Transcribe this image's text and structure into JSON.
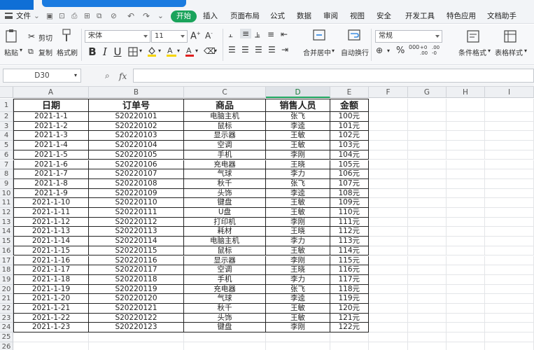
{
  "menu": {
    "file_label": "文件",
    "tabs": [
      "开始",
      "插入",
      "页面布局",
      "公式",
      "数据",
      "审阅",
      "视图",
      "安全",
      "开发工具",
      "特色应用",
      "文档助手"
    ],
    "active_tab": 0
  },
  "ribbon": {
    "paste": "粘贴",
    "cut": "剪切",
    "copy": "复制",
    "format_painter": "格式刷",
    "font_name": "宋体",
    "font_size": "11",
    "bold": "B",
    "italic": "I",
    "underline": "U",
    "merge_center": "合并居中",
    "wrap_text": "自动换行",
    "number_format": "常规",
    "percent": "%",
    "conditional_format": "条件格式",
    "table_style": "表格样式"
  },
  "formula_bar": {
    "name_box": "D30",
    "fx": "fx",
    "value": ""
  },
  "grid": {
    "columns": [
      "A",
      "B",
      "C",
      "D",
      "E",
      "F",
      "G",
      "H",
      "I"
    ],
    "selected_column": "D",
    "row_numbers": [
      "1",
      "2",
      "3",
      "4",
      "5",
      "6",
      "7",
      "8",
      "9",
      "10",
      "11",
      "12",
      "13",
      "14",
      "15",
      "16",
      "17",
      "18",
      "19",
      "20",
      "21",
      "22",
      "23",
      "24",
      "25",
      "26"
    ],
    "headers": [
      "日期",
      "订单号",
      "商品",
      "销售人员",
      "金额"
    ],
    "rows": [
      [
        "2021-1-1",
        "S20220101",
        "电脑主机",
        "张飞",
        "100元"
      ],
      [
        "2021-1-2",
        "S20220102",
        "鼠标",
        "李逵",
        "101元"
      ],
      [
        "2021-1-3",
        "S20220103",
        "显示器",
        "王敏",
        "102元"
      ],
      [
        "2021-1-4",
        "S20220104",
        "空调",
        "王敏",
        "103元"
      ],
      [
        "2021-1-5",
        "S20220105",
        "手机",
        "李刚",
        "104元"
      ],
      [
        "2021-1-6",
        "S20220106",
        "充电器",
        "王晓",
        "105元"
      ],
      [
        "2021-1-7",
        "S20220107",
        "气球",
        "李力",
        "106元"
      ],
      [
        "2021-1-8",
        "S20220108",
        "秋千",
        "张飞",
        "107元"
      ],
      [
        "2021-1-9",
        "S20220109",
        "头饰",
        "李逵",
        "108元"
      ],
      [
        "2021-1-10",
        "S20220110",
        "键盘",
        "王敏",
        "109元"
      ],
      [
        "2021-1-11",
        "S20220111",
        "U盘",
        "王敏",
        "110元"
      ],
      [
        "2021-1-12",
        "S20220112",
        "打印机",
        "李刚",
        "111元"
      ],
      [
        "2021-1-13",
        "S20220113",
        "耗材",
        "王晓",
        "112元"
      ],
      [
        "2021-1-14",
        "S20220114",
        "电脑主机",
        "李力",
        "113元"
      ],
      [
        "2021-1-15",
        "S20220115",
        "鼠标",
        "王敏",
        "114元"
      ],
      [
        "2021-1-16",
        "S20220116",
        "显示器",
        "李刚",
        "115元"
      ],
      [
        "2021-1-17",
        "S20220117",
        "空调",
        "王晓",
        "116元"
      ],
      [
        "2021-1-18",
        "S20220118",
        "手机",
        "李力",
        "117元"
      ],
      [
        "2021-1-19",
        "S20220119",
        "充电器",
        "张飞",
        "118元"
      ],
      [
        "2021-1-20",
        "S20220120",
        "气球",
        "李逵",
        "119元"
      ],
      [
        "2021-1-21",
        "S20220121",
        "秋千",
        "王敏",
        "120元"
      ],
      [
        "2021-1-22",
        "S20220122",
        "头饰",
        "王敏",
        "121元"
      ],
      [
        "2021-1-23",
        "S20220123",
        "键盘",
        "李刚",
        "122元"
      ]
    ]
  }
}
